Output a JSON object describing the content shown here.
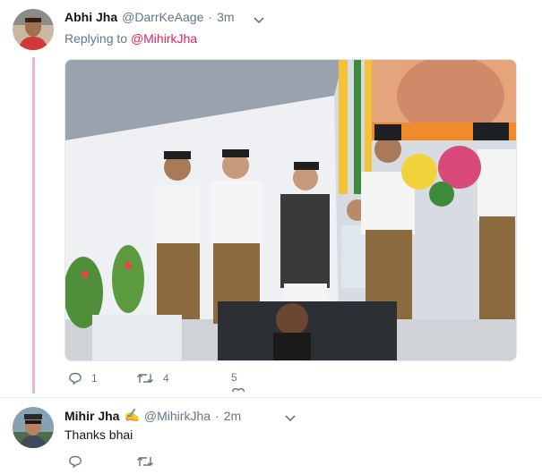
{
  "tweet1": {
    "display_name": "Abhi Jha",
    "handle": "@DarrKeAage",
    "separator": "·",
    "time": "3m",
    "replying_prefix": "Replying to",
    "replying_handle": "@MihirkJha",
    "actions": {
      "reply_count": "1",
      "retweet_count": "4",
      "like_count": "5"
    }
  },
  "tweet2": {
    "display_name": "Mihir Jha",
    "badge_emoji": "✍",
    "handle": "@MihirkJha",
    "separator": "·",
    "time": "2m",
    "text": "Thanks bhai"
  },
  "colors": {
    "accent": "#e0245e",
    "muted": "#657786",
    "thread_line": "#e8b6d4"
  }
}
